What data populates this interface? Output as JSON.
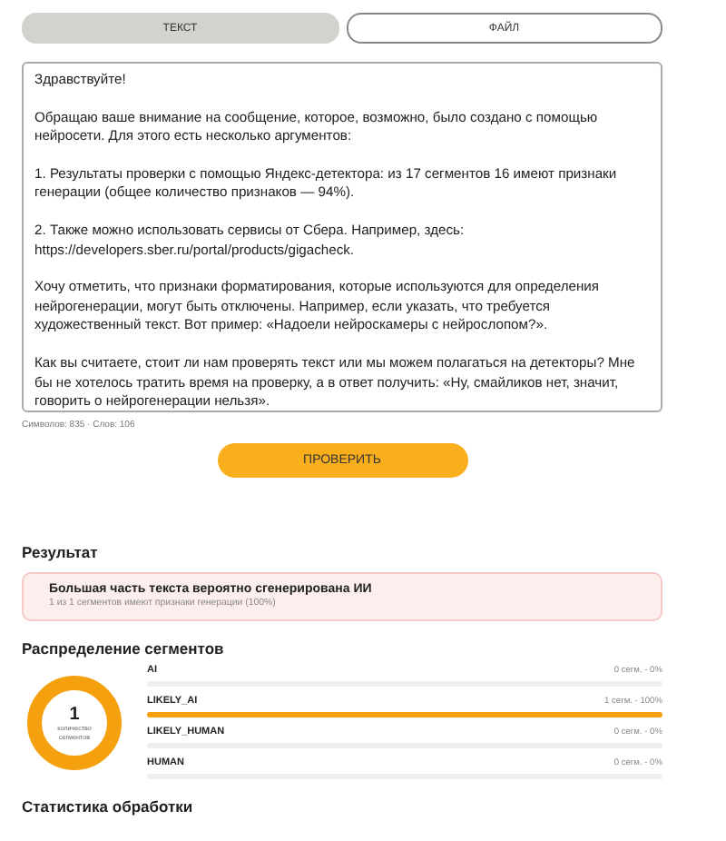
{
  "tabs": [
    {
      "label": "ТЕКСТ",
      "selected": true
    },
    {
      "label": "ФАЙЛ",
      "selected": false
    }
  ],
  "input": {
    "value": "Здравствуйте!\n\nОбращаю ваше внимание на сообщение, которое, возможно, было создано с помощью нейросети. Для этого есть несколько аргументов:\n\n1. Результаты проверки с помощью Яндекс-детектора: из 17 сегментов 16 имеют признаки генерации (общее количество признаков — 94%).\n\n2. Также можно использовать сервисы от Сбера. Например, здесь: https://developers.sber.ru/portal/products/gigacheck.\n\nХочу отметить, что признаки форматирования, которые используются для определения нейрогенерации, могут быть отключены. Например, если указать, что требуется художественный текст. Вот пример: «Надоели нейроскамеры с нейрослопом?».\n\nКак вы считаете, стоит ли нам проверять текст или мы можем полагаться на детекторы? Мне бы не хотелось тратить время на проверку, а в ответ получить: «Ну, смайликов нет, значит, говорить о нейрогенерации нельзя».",
    "counter": "Символов: 835 · Слов: 106"
  },
  "check_button": "ПРОВЕРИТЬ",
  "result": {
    "heading": "Результат",
    "title": "Большая часть текста вероятно сгенерирована ИИ",
    "subtitle": "1 из 1 сегментов имеют признаки генерации (100%)"
  },
  "distribution": {
    "heading": "Распределение сегментов",
    "total": "1",
    "total_label": "количество сегментов",
    "rows": [
      {
        "label": "AI",
        "reading": "0 сегм. - 0%",
        "level": 0
      },
      {
        "label": "LIKELY_AI",
        "reading": "1 сегм. - 100%",
        "level": 1
      },
      {
        "label": "LIKELY_HUMAN",
        "reading": "0 сегм. - 0%",
        "level": 0
      },
      {
        "label": "HUMAN",
        "reading": "0 сегм. - 0%",
        "level": 0
      }
    ]
  },
  "stats_heading": "Статистика обработки"
}
